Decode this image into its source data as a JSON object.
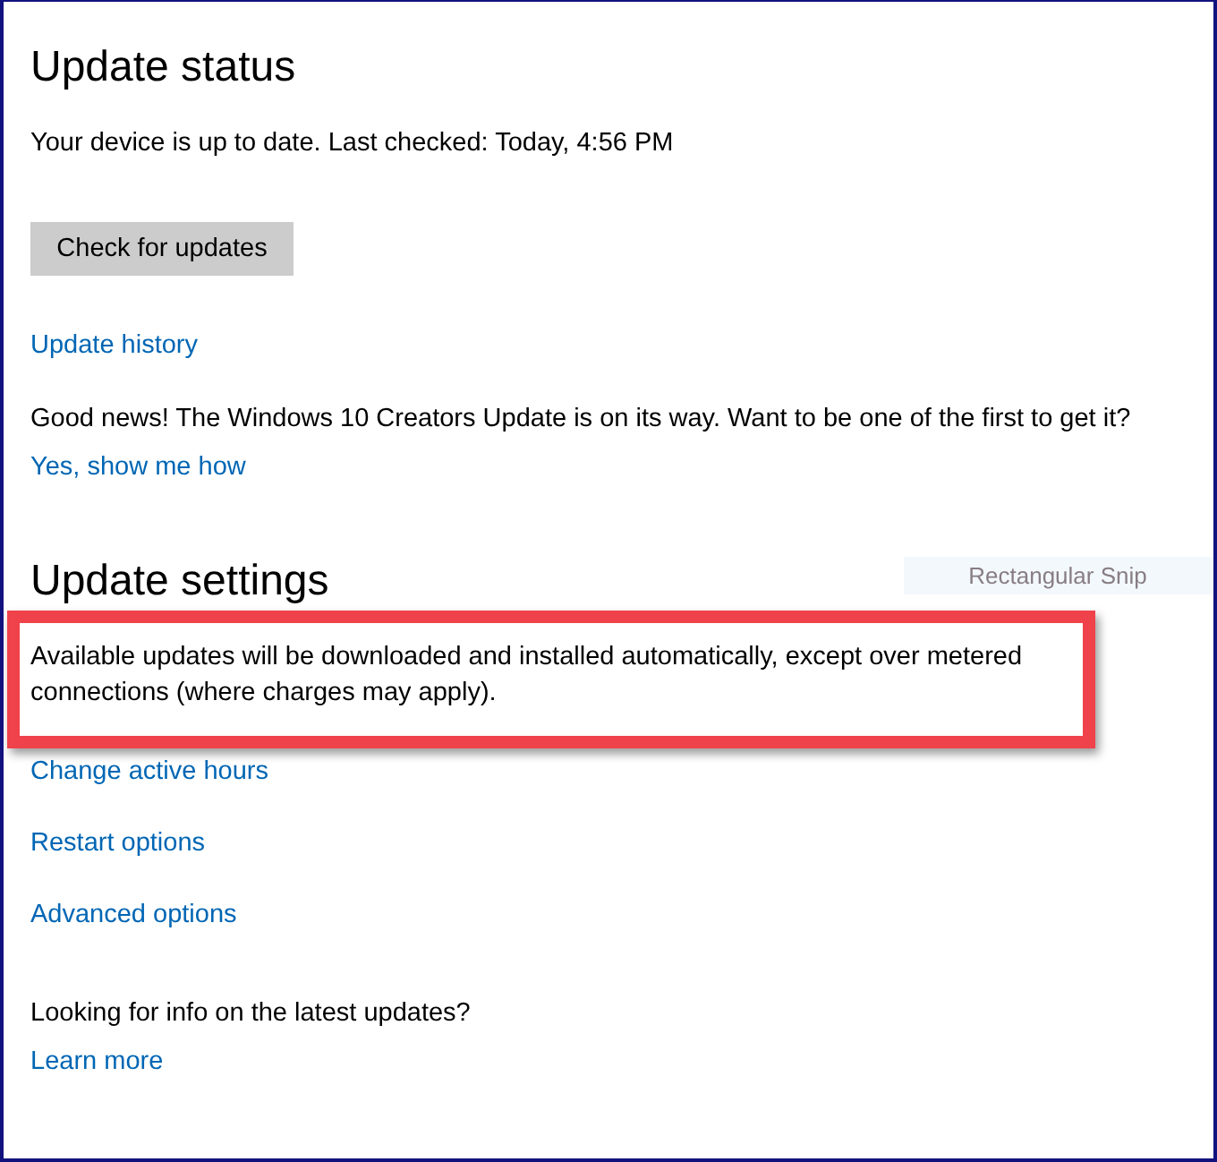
{
  "sections": [
    {
      "title": "Update status",
      "items": [
        {
          "kind": "text",
          "text": "Your device is up to date. Last checked: Today, 4:56 PM",
          "highlighted": false
        },
        {
          "kind": "button",
          "text": "Check for updates"
        },
        {
          "kind": "link",
          "text": "Update history"
        },
        {
          "kind": "text",
          "text": "Good news! The Windows 10 Creators Update is on its way. Want to be one of the first to get it?",
          "highlighted": false
        },
        {
          "kind": "link",
          "text": "Yes, show me how"
        }
      ]
    },
    {
      "title": "Update settings",
      "items": [
        {
          "kind": "text",
          "text": "Available updates will be downloaded and installed automatically, except over metered connections (where charges may apply).",
          "highlighted": true
        },
        {
          "kind": "link",
          "text": "Change active hours"
        },
        {
          "kind": "link",
          "text": "Restart options"
        },
        {
          "kind": "link",
          "text": "Advanced options"
        }
      ]
    }
  ],
  "footer": {
    "text": "Looking for info on the latest updates?",
    "link": "Learn more"
  },
  "tooltip": {
    "text": "Rectangular Snip"
  }
}
